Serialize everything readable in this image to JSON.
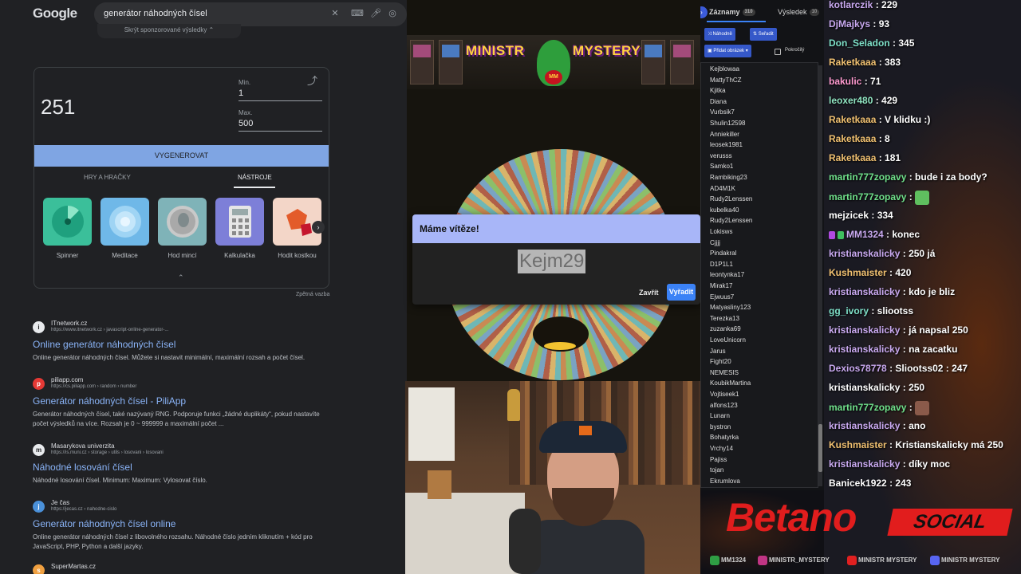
{
  "google": {
    "logo": "Google",
    "query": "generátor náhodných čísel",
    "sponsored_toggle": "Skrýt sponzorované výsledky",
    "rng": {
      "result": "251",
      "min_label": "Min.",
      "min_value": "1",
      "max_label": "Max.",
      "max_value": "500",
      "generate": "VYGENEROVAT",
      "tab_games": "HRY A HRAČKY",
      "tab_tools": "NÁSTROJE",
      "tools": [
        "Spinner",
        "Meditace",
        "Hod mincí",
        "Kalkulačka",
        "Hodit kostkou"
      ]
    },
    "feedback": "Zpětná vazba",
    "results": [
      {
        "site": "ITnetwork.cz",
        "url": "https://www.itnetwork.cz › javascript-online-generator-...",
        "title": "Online generátor náhodných čísel",
        "snippet": "Online generátor náhodných čísel. Můžete si nastavit minimální, maximální rozsah a počet čísel.",
        "fav": "i"
      },
      {
        "site": "piliapp.com",
        "url": "https://cs.piliapp.com › random › number",
        "title": "Generátor náhodných čísel - PiliApp",
        "snippet": "Generátor náhodných čísel, také nazývaný RNG. Podporuje funkci „žádné duplikáty“, pokud nastavíte počet výsledků na více. Rozsah je 0 ~ 999999 a maximální počet ...",
        "fav": "p"
      },
      {
        "site": "Masarykova univerzita",
        "url": "https://is.muni.cz › storage › utils › losovani › losovani",
        "title": "Náhodné losování čísel",
        "snippet": "Náhodné losování čísel. Minimum: Maximum: Vylosovat číslo.",
        "fav": "m"
      },
      {
        "site": "Je čas",
        "url": "https://jecas.cz › nahodne-cislo",
        "title": "Generátor náhodných čísel online",
        "snippet": "Online generátor náhodných čísel z libovolného rozsahu. Náhodné číslo jedním kliknutím + kód pro JavaScript, PHP, Python a další jazyky.",
        "fav": "j"
      },
      {
        "site": "SuperMartas.cz",
        "url": "",
        "title": "",
        "snippet": "",
        "fav": "s"
      }
    ]
  },
  "game": {
    "banner_left": "MINISTR",
    "banner_right": "MYSTERY",
    "mascot_badge": "MM"
  },
  "dialog": {
    "title": "Máme vítěze!",
    "winner": "Kejm29",
    "close": "Zavřít",
    "remove": "Vyřadit"
  },
  "entries": {
    "tab_entries": "Záznamy",
    "tab_entries_count": "310",
    "tab_results": "Výsledek",
    "tab_results_count": "10",
    "shuffle": "Náhodně",
    "sort": "Seřadit",
    "add_image": "Přidat obrázek",
    "advanced": "Pokročilý",
    "items": [
      "Kejblowaa",
      "MattyThCZ",
      "Kjitka",
      "Diana",
      "Vurbsik7",
      "Shulin12598",
      "Anniekiller",
      "leosek1981",
      "verusss",
      "Samko1",
      "Rambiking23",
      "AD4M1K",
      "Rudy2Lenssen",
      "kubelka40",
      "Rudy2Lenssen",
      "Lokisws",
      "Cjjjj",
      "Pindakral",
      "D1P1L1",
      "leontynka17",
      "Mirak17",
      "Ejwuus7",
      "Matyasliny123",
      "Terezka13",
      "zuzanka69",
      "LoveUnicorn",
      "Jarus",
      "Fight20",
      "NEMESIS",
      "KoubikMartina",
      "Vojtiseek1",
      "alfons123",
      "Lunarn",
      "bystron",
      "Bohatyrka",
      "Vrchy14",
      "Pajiss",
      "tojan",
      "Ekrumlova"
    ]
  },
  "chat": {
    "messages": [
      {
        "user": "kotlarczik",
        "text": " : 229",
        "color": "#c9a9f0"
      },
      {
        "user": "DjMajkys",
        "text": " : 93",
        "color": "#c9a9f0"
      },
      {
        "user": "Don_Seladon",
        "text": " : 345",
        "color": "#7ee0c8"
      },
      {
        "user": "Raketkaaa",
        "text": " : 383",
        "color": "#f0c070"
      },
      {
        "user": "bakulic",
        "text": " : 71",
        "color": "#ff9ad0"
      },
      {
        "user": "leoxer480",
        "text": " : 429",
        "color": "#8fe3c0"
      },
      {
        "user": "Raketkaaa",
        "text": " : V klidku :)",
        "color": "#f0c070"
      },
      {
        "user": "Raketkaaa",
        "text": " : 8",
        "color": "#f0c070"
      },
      {
        "user": "Raketkaaa",
        "text": " : 181",
        "color": "#f0c070"
      },
      {
        "user": "martin777zopavy",
        "text": " : bude i za body?",
        "color": "#6fe08a"
      },
      {
        "user": "martin777zopavy",
        "text": " : ",
        "color": "#6fe08a",
        "emote": "#5fbf5f"
      },
      {
        "user": "mejzicek",
        "text": " : 334",
        "color": "#ffffff"
      },
      {
        "user": "MM1324",
        "text": " : konec",
        "color": "#c9a9f0",
        "badges": [
          "#b04ae0",
          "#3fbf5f"
        ]
      },
      {
        "user": "kristianskalicky",
        "text": " : 250 já",
        "color": "#c9a9f0"
      },
      {
        "user": "Kushmaister",
        "text": " : 420",
        "color": "#f0c070"
      },
      {
        "user": "kristianskalicky",
        "text": " : kdo je bliz",
        "color": "#c9a9f0"
      },
      {
        "user": "gg_ivory",
        "text": " : sliootss",
        "color": "#7ee0c8"
      },
      {
        "user": "kristianskalicky",
        "text": " : já napsal 250",
        "color": "#c9a9f0"
      },
      {
        "user": "kristianskalicky",
        "text": " : na zacatku",
        "color": "#c9a9f0"
      },
      {
        "user": "Dexios78778",
        "text": " : Sliootss02 : 247",
        "color": "#c9a9f0"
      },
      {
        "user": "kristianskalicky",
        "text": " : 250",
        "color": "#ffffff"
      },
      {
        "user": "martin777zopavy",
        "text": " : ",
        "color": "#6fe08a",
        "emote": "#8a5a4a"
      },
      {
        "user": "kristianskalicky",
        "text": " : ano",
        "color": "#c9a9f0"
      },
      {
        "user": "Kushmaister",
        "text": " : Kristianskalicky má 250",
        "color": "#f0c070"
      },
      {
        "user": "kristianskalicky",
        "text": " : díky moc",
        "color": "#c9a9f0"
      },
      {
        "user": "Banicek1922",
        "text": " : 243",
        "color": "#ffffff"
      }
    ]
  },
  "brand": {
    "name": "Betano",
    "tag": "SOCIAL"
  },
  "socials": [
    {
      "handle": "MM1324",
      "icon": "xbox-icon",
      "color": "#2f9e44"
    },
    {
      "handle": "MINISTR_MYSTERY",
      "icon": "instagram-icon",
      "color": "#c13584"
    },
    {
      "handle": "MINISTR MYSTERY",
      "icon": "youtube-icon",
      "color": "#e02020"
    },
    {
      "handle": "MINISTR MYSTERY",
      "icon": "discord-icon",
      "color": "#5865f2"
    }
  ]
}
